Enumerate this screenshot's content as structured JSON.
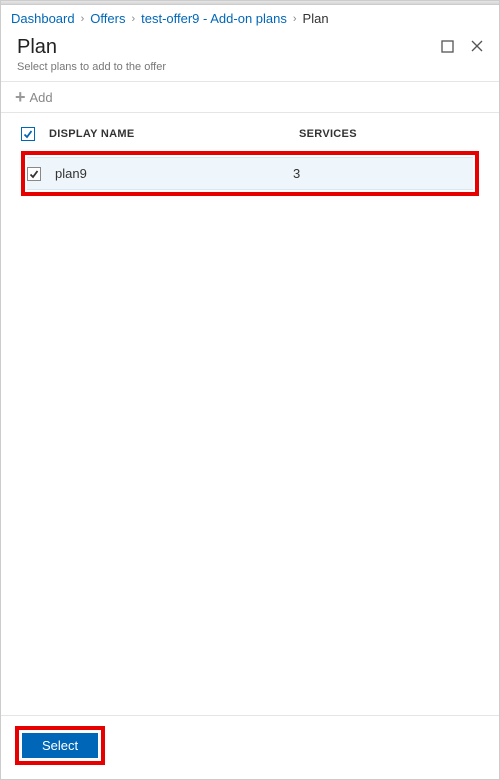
{
  "breadcrumb": {
    "items": [
      "Dashboard",
      "Offers",
      "test-offer9 - Add-on plans"
    ],
    "current": "Plan"
  },
  "header": {
    "title": "Plan",
    "subtitle": "Select plans to add to the offer"
  },
  "toolbar": {
    "add_label": "Add"
  },
  "table": {
    "columns": {
      "name": "DISPLAY NAME",
      "services": "SERVICES"
    },
    "rows": [
      {
        "checked": true,
        "name": "plan9",
        "services": "3"
      }
    ]
  },
  "footer": {
    "select_label": "Select"
  }
}
